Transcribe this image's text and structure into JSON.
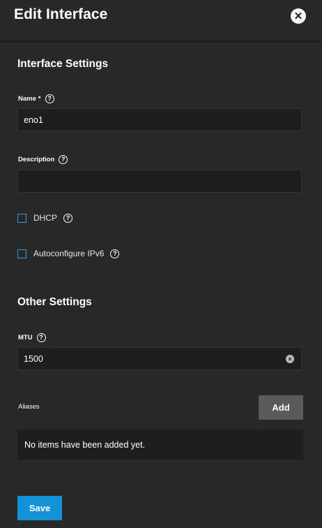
{
  "header": {
    "title": "Edit Interface",
    "close_icon": "close-icon"
  },
  "interface_settings": {
    "title": "Interface Settings",
    "name": {
      "label": "Name",
      "required_mark": "*",
      "value": "eno1",
      "help": "?"
    },
    "description": {
      "label": "Description",
      "value": "",
      "help": "?"
    },
    "dhcp": {
      "label": "DHCP",
      "checked": false,
      "help": "?"
    },
    "ipv6": {
      "label": "Autoconfigure IPv6",
      "checked": false,
      "help": "?"
    }
  },
  "other_settings": {
    "title": "Other Settings",
    "mtu": {
      "label": "MTU",
      "value": "1500",
      "help": "?",
      "clear": "×"
    }
  },
  "aliases": {
    "label": "Aliases",
    "add_label": "Add",
    "empty_text": "No items have been added yet."
  },
  "save_label": "Save",
  "colors": {
    "accent": "#1492d8",
    "background": "#282828",
    "input_bg": "#1e1e1e"
  }
}
